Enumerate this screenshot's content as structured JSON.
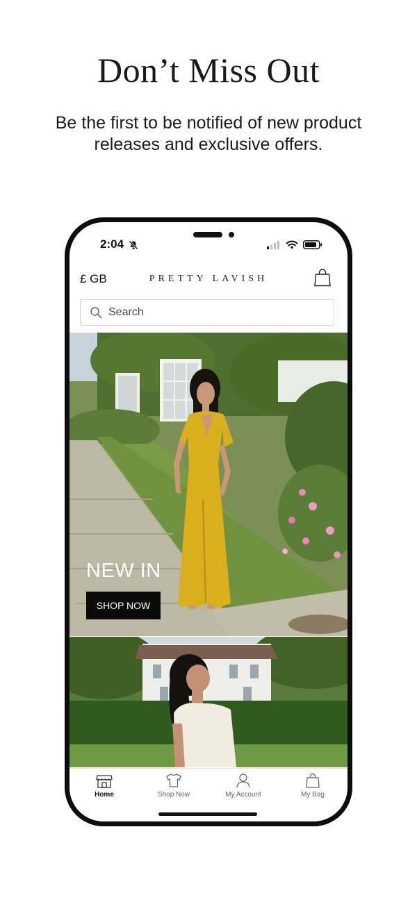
{
  "promo": {
    "headline": "Don’t Miss Out",
    "subline": "Be the first to be notified of new product releases and exclusive offers."
  },
  "status_bar": {
    "time": "2:04",
    "icons": [
      "bell-slash-icon",
      "cellular-signal-icon",
      "wifi-icon",
      "battery-icon"
    ]
  },
  "header": {
    "currency": "£ GB",
    "brand": "PRETTY LAVISH",
    "bag_icon": "shopping-bag-icon"
  },
  "search": {
    "placeholder": "Search",
    "icon": "search-icon"
  },
  "hero": {
    "title": "NEW IN",
    "button_label": "SHOP NOW"
  },
  "tab_bar": {
    "items": [
      {
        "label": "Home",
        "icon": "storefront-icon",
        "active": true
      },
      {
        "label": "Shop Now",
        "icon": "tshirt-icon",
        "active": false
      },
      {
        "label": "My Account",
        "icon": "user-icon",
        "active": false
      },
      {
        "label": "My Bag",
        "icon": "shopping-bag-icon",
        "active": false
      }
    ]
  },
  "colors": {
    "accent_dress": "#d9ae1f",
    "button_bg": "#0a0a0a",
    "frame": "#0d0d0d"
  }
}
